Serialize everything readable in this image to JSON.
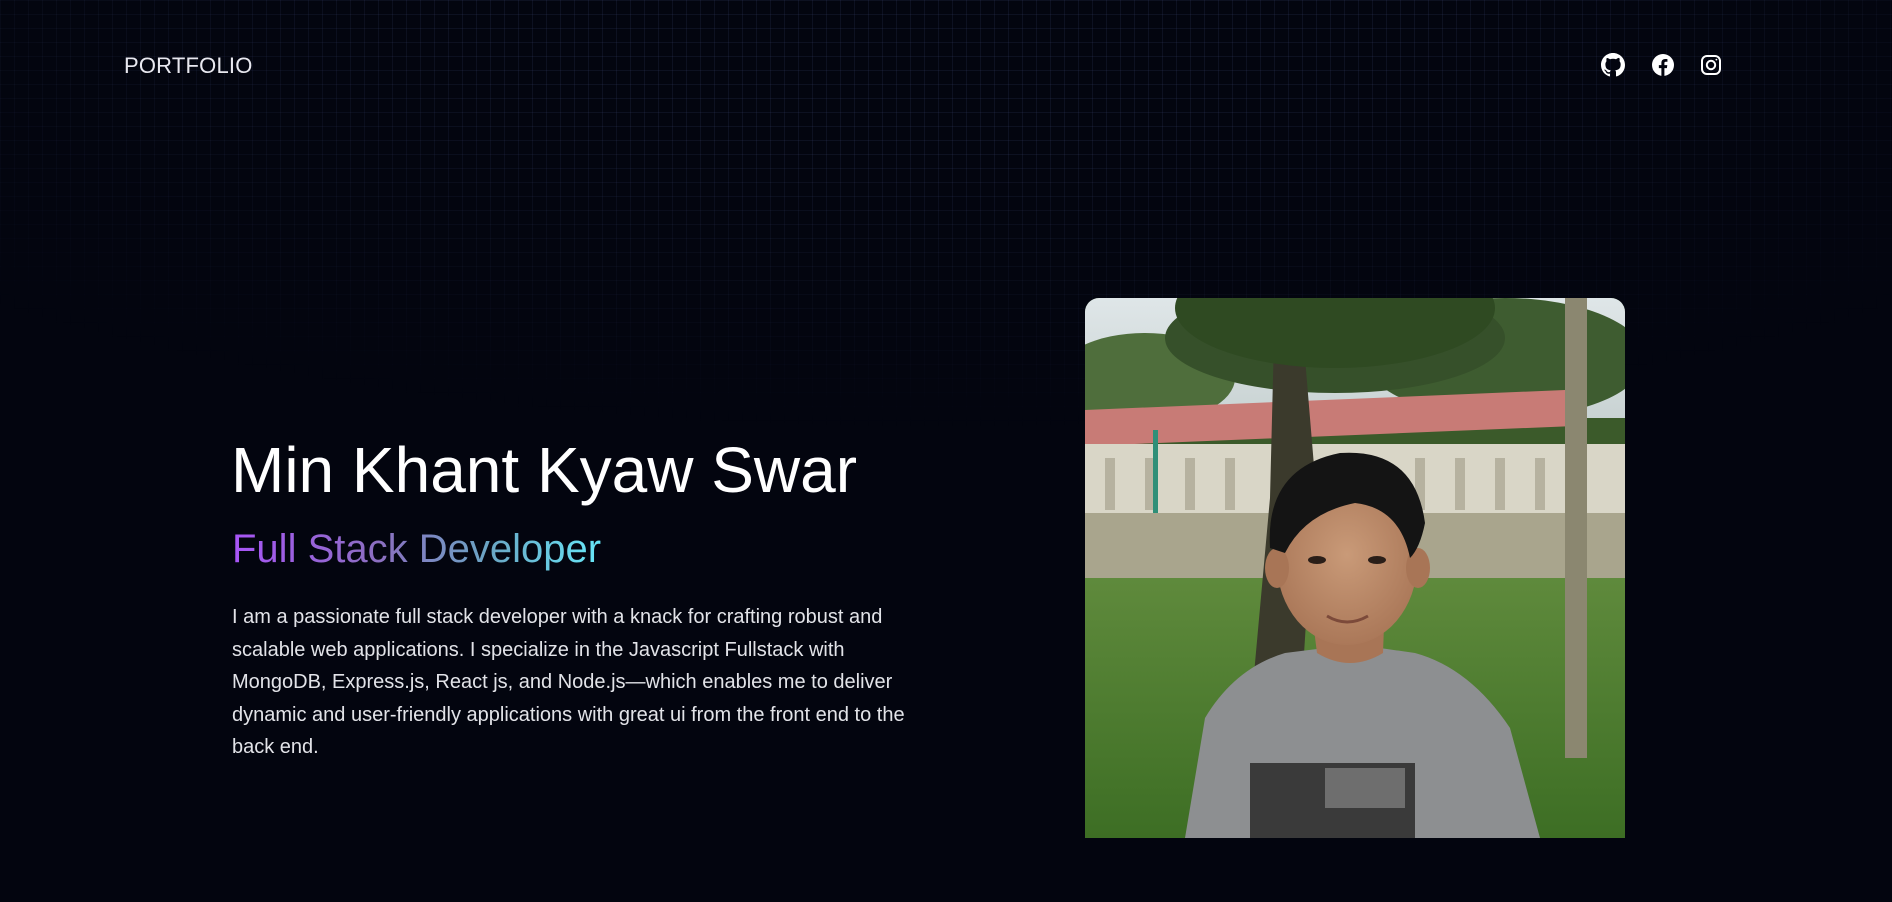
{
  "header": {
    "logo_text": "PORTFOLIO",
    "social_links": [
      {
        "icon": "github-icon"
      },
      {
        "icon": "facebook-icon"
      },
      {
        "icon": "instagram-icon"
      }
    ]
  },
  "hero": {
    "name": "Min Khant Kyaw Swar",
    "role": "Full Stack Developer",
    "description": "I am a passionate full stack developer with a knack for crafting robust and scalable web applications. I specialize in the Javascript Fullstack with MongoDB, Express.js, React js, and Node.js—which enables me to deliver dynamic and user-friendly applications with great ui from the front end to the back end."
  },
  "colors": {
    "background": "#03050f",
    "gradient_start": "#a855f7",
    "gradient_end": "#67e8f9"
  }
}
